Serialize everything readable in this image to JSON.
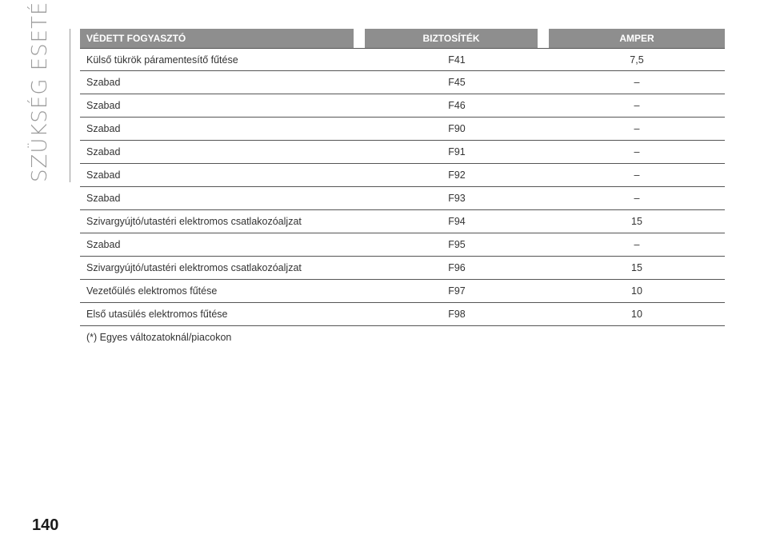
{
  "section_title": "SZÜKSÉG ESETÉN",
  "table": {
    "headers": [
      "VÉDETT FOGYASZTÓ",
      "BIZTOSÍTÉK",
      "AMPER"
    ],
    "rows": [
      [
        "Külső tükrök páramentesítő fűtése",
        "F41",
        "7,5"
      ],
      [
        "Szabad",
        "F45",
        "–"
      ],
      [
        "Szabad",
        "F46",
        "–"
      ],
      [
        "Szabad",
        "F90",
        "–"
      ],
      [
        "Szabad",
        "F91",
        "–"
      ],
      [
        "Szabad",
        "F92",
        "–"
      ],
      [
        "Szabad",
        "F93",
        "–"
      ],
      [
        "Szivargyújtó/utastéri elektromos csatlakozóaljzat",
        "F94",
        "15"
      ],
      [
        "Szabad",
        "F95",
        "–"
      ],
      [
        "Szivargyújtó/utastéri elektromos csatlakozóaljzat",
        "F96",
        "15"
      ],
      [
        "Vezetőülés elektromos fűtése",
        "F97",
        "10"
      ],
      [
        "Első utasülés elektromos fűtése",
        "F98",
        "10"
      ]
    ],
    "footnote": "(*) Egyes változatoknál/piacokon"
  },
  "page_number": "140"
}
